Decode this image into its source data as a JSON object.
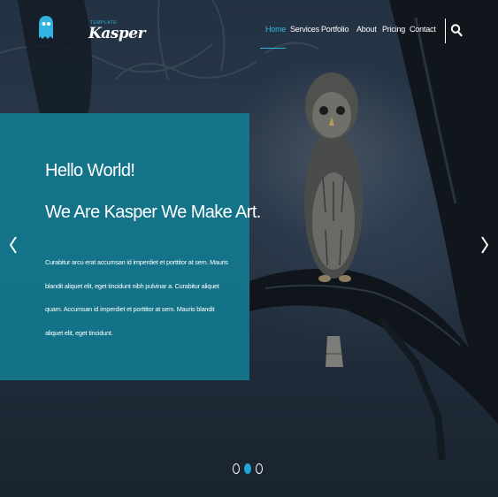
{
  "brand": {
    "name": "Kasper",
    "tagline": "TEMPLATE",
    "accent_color": "#2fb8dd"
  },
  "nav": {
    "items": [
      {
        "label": "Home",
        "active": true
      },
      {
        "label": "Services",
        "active": false
      },
      {
        "label": "Portfolio",
        "active": false
      },
      {
        "label": "About",
        "active": false
      },
      {
        "label": "Pricing",
        "active": false
      },
      {
        "label": "Contact",
        "active": false
      }
    ],
    "search_icon": "search-icon"
  },
  "hero": {
    "title_line1": "Hello World!",
    "title_line2": "We Are Kasper We Make Art.",
    "body": "Curabitur arcu erat accumsan id imperdiet et porttitor at sem. Mauris blandit aliquet elit, eget tincidunt nibh pulvinar a. Curabitur aliquet quam. Accumsan id imperdiet et porttitor at sem. Mauris blandit aliquet elit, eget tincidunt.",
    "panel_color": "#127e94",
    "prev_icon": "chevron-left-icon",
    "next_icon": "chevron-right-icon"
  },
  "slider": {
    "slide_count": 3,
    "active_index": 1,
    "active_color": "#21a6d6"
  }
}
